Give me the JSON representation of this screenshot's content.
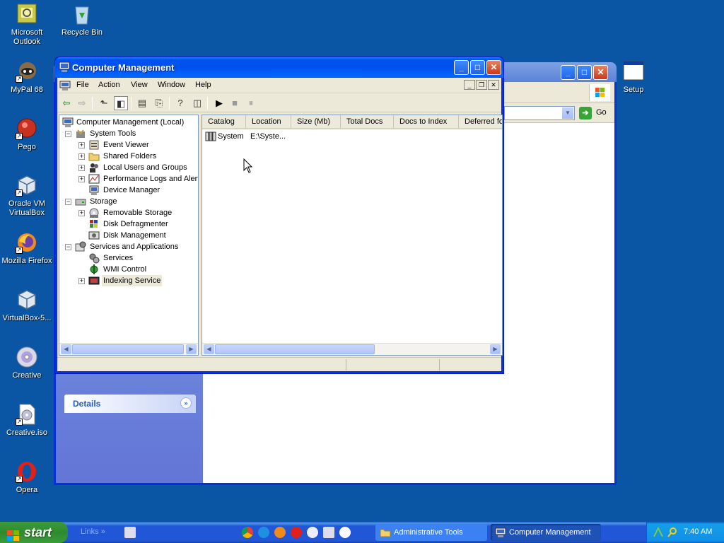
{
  "desktop": {
    "icons": [
      {
        "label": "Microsoft Outlook",
        "icon": "outlook-icon"
      },
      {
        "label": "Recycle Bin",
        "icon": "recycle-bin-icon"
      },
      {
        "label": "MyPal 68",
        "icon": "mypal-icon"
      },
      {
        "label": "Pego",
        "icon": "pego-icon"
      },
      {
        "label": "Oracle VM VirtualBox",
        "icon": "virtualbox-icon"
      },
      {
        "label": "Mozilla Firefox",
        "icon": "firefox-icon"
      },
      {
        "label": "VirtualBox-5...",
        "icon": "virtualbox-installer-icon"
      },
      {
        "label": "Creative",
        "icon": "cd-icon"
      },
      {
        "label": "Creative.iso",
        "icon": "iso-file-icon"
      },
      {
        "label": "Opera",
        "icon": "opera-icon"
      },
      {
        "label": "Setup",
        "icon": "setup-window-icon"
      }
    ]
  },
  "background_window": {
    "go_label": "Go",
    "details_label": "Details"
  },
  "window": {
    "title": "Computer Management",
    "menu": [
      "File",
      "Action",
      "View",
      "Window",
      "Help"
    ],
    "tree": [
      {
        "label": "Computer Management (Local)",
        "level": 0,
        "icon": "computer-icon"
      },
      {
        "label": "System Tools",
        "level": 1,
        "expander": "−",
        "icon": "tools-icon"
      },
      {
        "label": "Event Viewer",
        "level": 2,
        "expander": "+",
        "icon": "event-viewer-icon"
      },
      {
        "label": "Shared Folders",
        "level": 2,
        "expander": "+",
        "icon": "shared-folder-icon"
      },
      {
        "label": "Local Users and Groups",
        "level": 2,
        "expander": "+",
        "icon": "users-icon"
      },
      {
        "label": "Performance Logs and Alerts",
        "level": 2,
        "expander": "+",
        "icon": "performance-icon"
      },
      {
        "label": "Device Manager",
        "level": 2,
        "icon": "device-manager-icon"
      },
      {
        "label": "Storage",
        "level": 1,
        "expander": "−",
        "icon": "storage-icon"
      },
      {
        "label": "Removable Storage",
        "level": 2,
        "expander": "+",
        "icon": "removable-storage-icon"
      },
      {
        "label": "Disk Defragmenter",
        "level": 2,
        "icon": "defrag-icon"
      },
      {
        "label": "Disk Management",
        "level": 2,
        "icon": "disk-management-icon"
      },
      {
        "label": "Services and Applications",
        "level": 1,
        "expander": "−",
        "icon": "services-apps-icon"
      },
      {
        "label": "Services",
        "level": 2,
        "icon": "services-icon"
      },
      {
        "label": "WMI Control",
        "level": 2,
        "icon": "wmi-icon"
      },
      {
        "label": "Indexing Service",
        "level": 2,
        "expander": "+",
        "icon": "indexing-icon",
        "selected": true
      }
    ],
    "list": {
      "columns": [
        "Catalog",
        "Location",
        "Size (Mb)",
        "Total Docs",
        "Docs to Index",
        "Deferred fo"
      ],
      "rows": [
        {
          "catalog": "System",
          "location": "E:\\Syste..."
        }
      ]
    }
  },
  "taskbar": {
    "start_label": "start",
    "links_label": "Links",
    "tasks": [
      {
        "label": "Administrative Tools",
        "active": false
      },
      {
        "label": "Computer Management",
        "active": true
      }
    ],
    "clock": "7:40 AM"
  }
}
